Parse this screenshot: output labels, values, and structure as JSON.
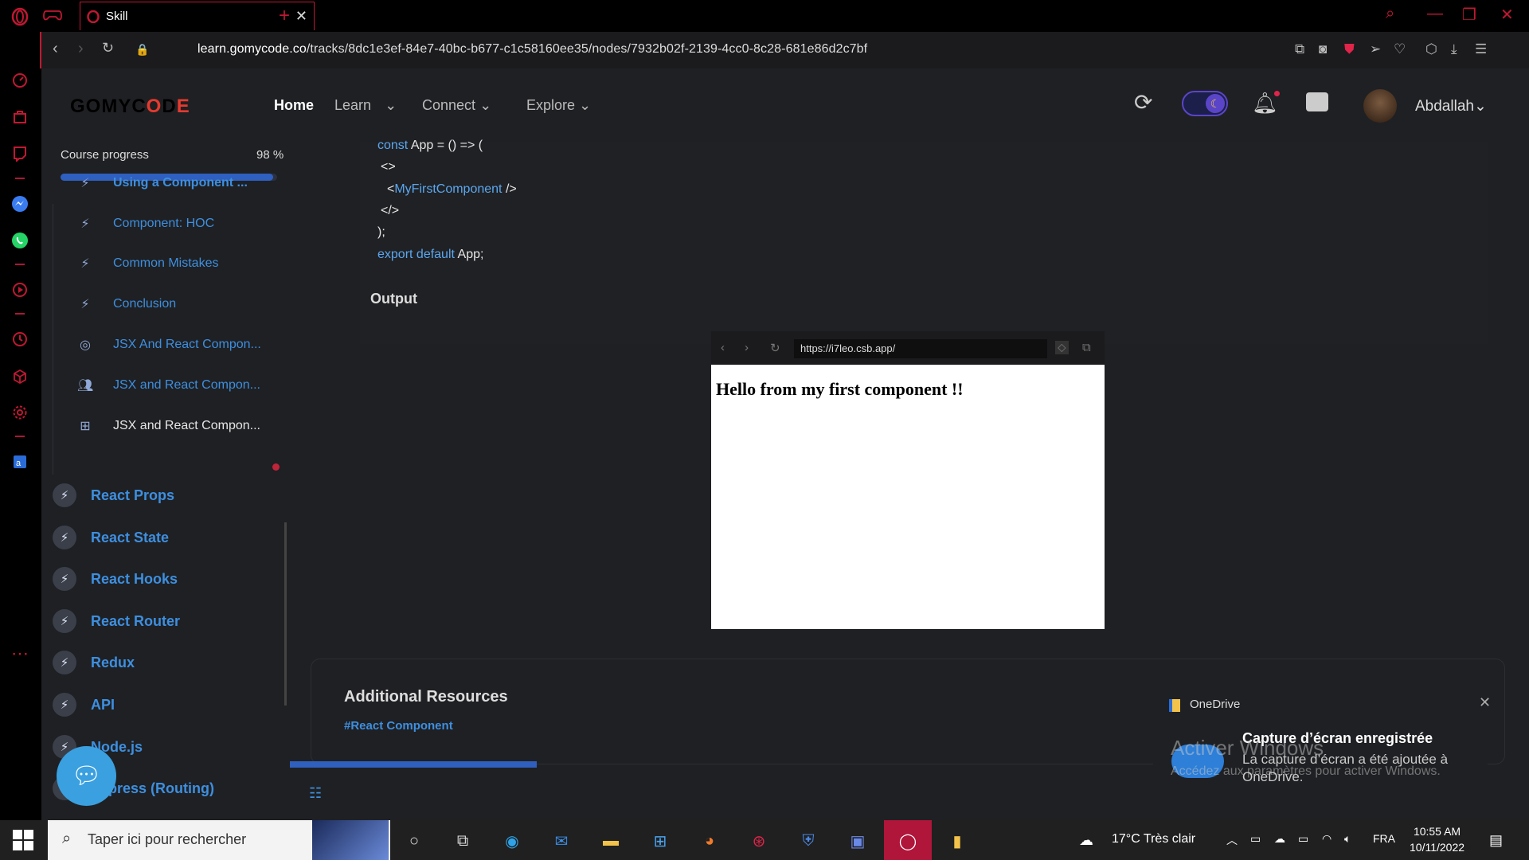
{
  "browser": {
    "tab_title": "Skill",
    "url_host": "learn.gomycode.co",
    "url_path": "/tracks/8dc1e3ef-84e7-40bc-b677-c1c58160ee35/nodes/7932b02f-2139-4cc0-8c28-681e86d2c7bf"
  },
  "header": {
    "logo_prefix": "GOMYC",
    "logo_accent": "O",
    "logo_mid": "D",
    "logo_accent2": "E",
    "nav": {
      "home": "Home",
      "learn": "Learn",
      "connect": "Connect",
      "explore": "Explore"
    },
    "username": "Abdallah"
  },
  "sidebar": {
    "progress_label": "Course progress",
    "progress_value": "98 %",
    "progress_fraction": 0.98,
    "lessons": [
      {
        "label": "Using a Component ...",
        "icon": "bolt-icon"
      },
      {
        "label": "Component: HOC",
        "icon": "bolt-icon"
      },
      {
        "label": "Common Mistakes",
        "icon": "bolt-icon"
      },
      {
        "label": "Conclusion",
        "icon": "bolt-icon"
      },
      {
        "label": "JSX And React Compon...",
        "icon": "target-icon"
      },
      {
        "label": "JSX and React Compon...",
        "icon": "people-icon"
      },
      {
        "label": "JSX and React Compon...",
        "icon": "board-icon"
      }
    ],
    "modules": [
      "React Props",
      "React State",
      "React Hooks",
      "React Router",
      "Redux",
      "API",
      "Node.js",
      "Express (Routing)"
    ]
  },
  "code": {
    "line1_kw": "const",
    "line1_rest": " App = () => (",
    "line2": "<>",
    "line3_open": "<",
    "line3_comp": "MyFirstComponent",
    "line3_close": " />",
    "line4": "</>",
    "line5": ");",
    "line6_kw": "export default",
    "line6_rest": " App;"
  },
  "output": {
    "label": "Output",
    "preview_url": "https://i7leo.csb.app/",
    "preview_text": "Hello from my first component !!"
  },
  "resources": {
    "title": "Additional Resources",
    "tag": "#React Component"
  },
  "notification": {
    "app": "OneDrive",
    "title": "Capture d’écran enregistrée",
    "body": "La capture d’écran a été ajoutée à OneDrive.",
    "watermark_title": "Activer Windows",
    "watermark_body": "Accédez aux paramètres pour activer Windows."
  },
  "taskbar": {
    "search_placeholder": "Taper ici pour rechercher",
    "weather": "17°C  Très clair",
    "language": "FRA",
    "time": "10:55 AM",
    "date": "10/11/2022"
  },
  "colors": {
    "accent": "#3d8fe0",
    "opera_red": "#c01832",
    "progress": "#2f5fbf"
  }
}
